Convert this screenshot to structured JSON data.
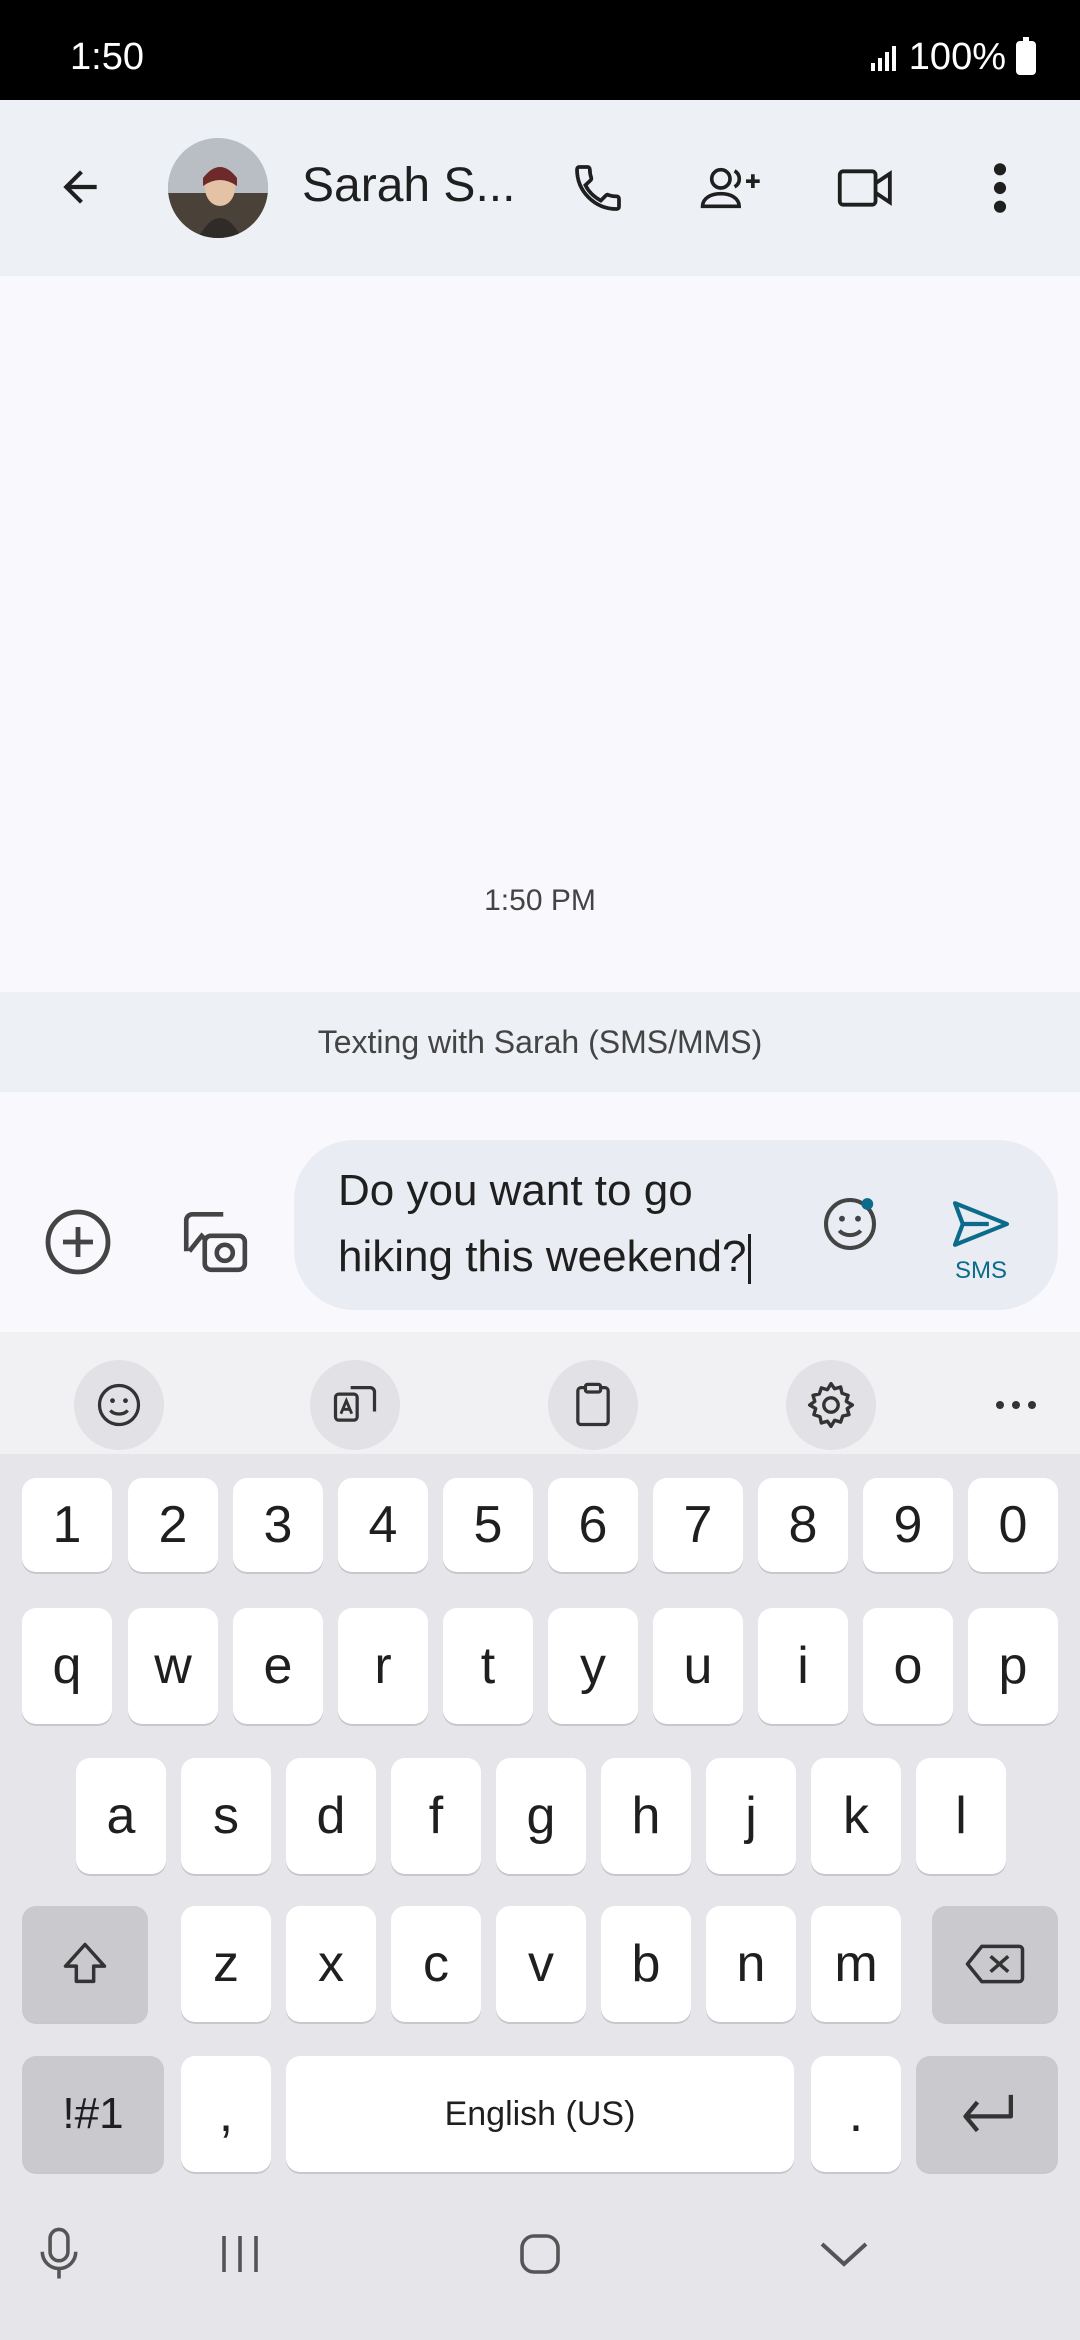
{
  "status_bar": {
    "time": "1:50",
    "battery": "100%"
  },
  "header": {
    "contact_name": "Sarah S..."
  },
  "conversation": {
    "timestamp": "1:50 PM",
    "banner": "Texting with Sarah (SMS/MMS)"
  },
  "compose": {
    "line1": "Do you want to go",
    "line2": "hiking this weekend?",
    "send_label": "SMS"
  },
  "keyboard": {
    "number_row": [
      "1",
      "2",
      "3",
      "4",
      "5",
      "6",
      "7",
      "8",
      "9",
      "0"
    ],
    "row1": [
      "q",
      "w",
      "e",
      "r",
      "t",
      "y",
      "u",
      "i",
      "o",
      "p"
    ],
    "row2": [
      "a",
      "s",
      "d",
      "f",
      "g",
      "h",
      "j",
      "k",
      "l"
    ],
    "row3": [
      "z",
      "x",
      "c",
      "v",
      "b",
      "n",
      "m"
    ],
    "symbols_label": "!#1",
    "comma": ",",
    "space_label": "English (US)",
    "period": "."
  },
  "colors": {
    "accent": "#0b6b8a",
    "app_bar": "#edf0f4",
    "background": "#f9f9fd"
  }
}
